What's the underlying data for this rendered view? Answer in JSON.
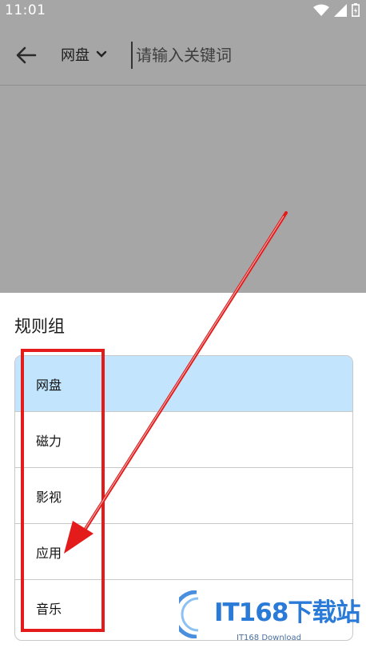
{
  "status_bar": {
    "time": "11:01"
  },
  "toolbar": {
    "category": "网盘",
    "search_placeholder": "请输入关键词"
  },
  "sheet": {
    "title": "规则组",
    "items": [
      {
        "label": "网盘",
        "selected": true
      },
      {
        "label": "磁力",
        "selected": false
      },
      {
        "label": "影视",
        "selected": false
      },
      {
        "label": "应用",
        "selected": false
      },
      {
        "label": "音乐",
        "selected": false
      }
    ]
  },
  "watermark": {
    "title": "IT168下载站",
    "subtitle": "IT168 Download"
  },
  "colors": {
    "annotation": "#e31b1b",
    "selected": "#c2e5fd",
    "scrim": "#a6a6a6"
  }
}
